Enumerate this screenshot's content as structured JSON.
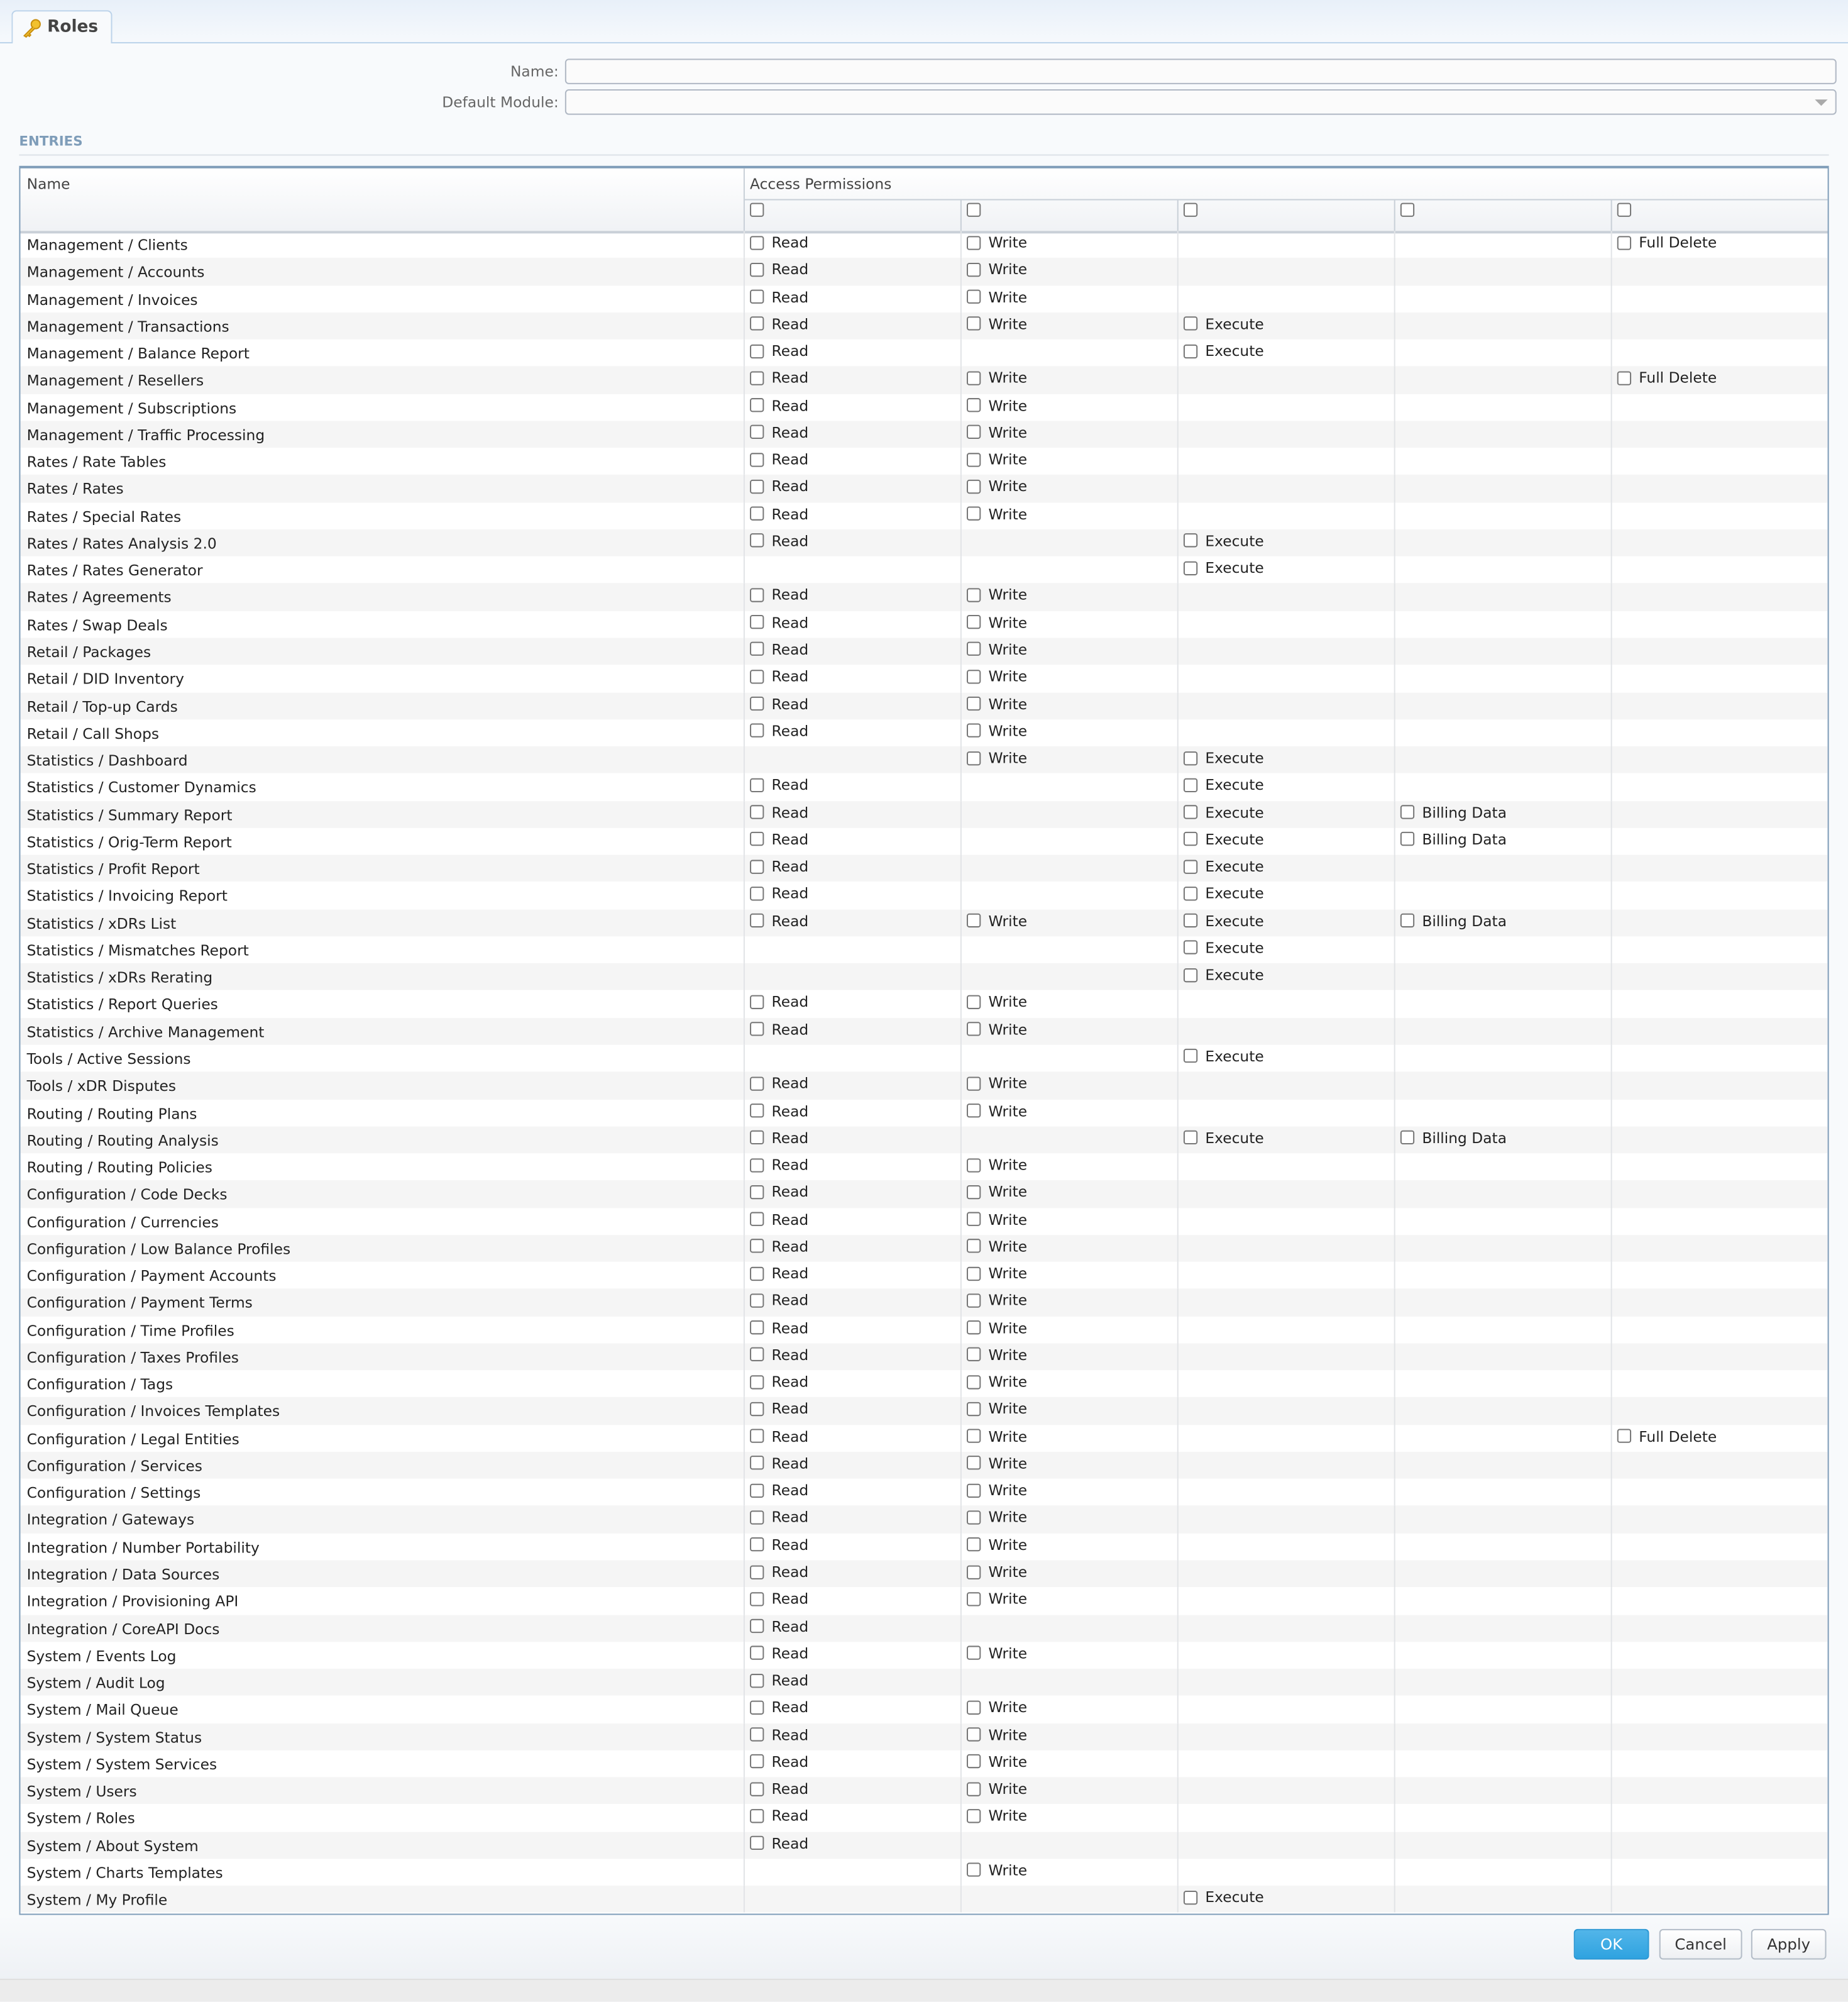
{
  "tab": {
    "title": "Roles",
    "icon": "key-icon"
  },
  "form": {
    "name_label": "Name:",
    "name_value": "",
    "module_label": "Default Module:",
    "module_value": ""
  },
  "section_title": "ENTRIES",
  "table": {
    "col_name": "Name",
    "col_permissions": "Access Permissions",
    "perm_labels": {
      "R": "Read",
      "W": "Write",
      "E": "Execute",
      "B": "Billing Data",
      "F": "Full Delete"
    },
    "rows": [
      {
        "name": "Management / Clients",
        "p": "RW--F"
      },
      {
        "name": "Management / Accounts",
        "p": "RW---"
      },
      {
        "name": "Management / Invoices",
        "p": "RW---"
      },
      {
        "name": "Management / Transactions",
        "p": "RWE--"
      },
      {
        "name": "Management / Balance Report",
        "p": "R-E--"
      },
      {
        "name": "Management / Resellers",
        "p": "RW--F"
      },
      {
        "name": "Management / Subscriptions",
        "p": "RW---"
      },
      {
        "name": "Management / Traffic Processing",
        "p": "RW---"
      },
      {
        "name": "Rates / Rate Tables",
        "p": "RW---"
      },
      {
        "name": "Rates / Rates",
        "p": "RW---"
      },
      {
        "name": "Rates / Special Rates",
        "p": "RW---"
      },
      {
        "name": "Rates / Rates Analysis 2.0",
        "p": "R-E--"
      },
      {
        "name": "Rates / Rates Generator",
        "p": "--E--"
      },
      {
        "name": "Rates / Agreements",
        "p": "RW---"
      },
      {
        "name": "Rates / Swap Deals",
        "p": "RW---"
      },
      {
        "name": "Retail / Packages",
        "p": "RW---"
      },
      {
        "name": "Retail / DID Inventory",
        "p": "RW---"
      },
      {
        "name": "Retail / Top-up Cards",
        "p": "RW---"
      },
      {
        "name": "Retail / Call Shops",
        "p": "RW---"
      },
      {
        "name": "Statistics / Dashboard",
        "p": "-WE--"
      },
      {
        "name": "Statistics / Customer Dynamics",
        "p": "R-E--"
      },
      {
        "name": "Statistics / Summary Report",
        "p": "R-EB-"
      },
      {
        "name": "Statistics / Orig-Term Report",
        "p": "R-EB-"
      },
      {
        "name": "Statistics / Profit Report",
        "p": "R-E--"
      },
      {
        "name": "Statistics / Invoicing Report",
        "p": "R-E--"
      },
      {
        "name": "Statistics / xDRs List",
        "p": "RWEB-"
      },
      {
        "name": "Statistics / Mismatches Report",
        "p": "--E--"
      },
      {
        "name": "Statistics / xDRs Rerating",
        "p": "--E--"
      },
      {
        "name": "Statistics / Report Queries",
        "p": "RW---"
      },
      {
        "name": "Statistics / Archive Management",
        "p": "RW---"
      },
      {
        "name": "Tools / Active Sessions",
        "p": "--E--"
      },
      {
        "name": "Tools / xDR Disputes",
        "p": "RW---"
      },
      {
        "name": "Routing / Routing Plans",
        "p": "RW---"
      },
      {
        "name": "Routing / Routing Analysis",
        "p": "R-EB-"
      },
      {
        "name": "Routing / Routing Policies",
        "p": "RW---"
      },
      {
        "name": "Configuration / Code Decks",
        "p": "RW---"
      },
      {
        "name": "Configuration / Currencies",
        "p": "RW---"
      },
      {
        "name": "Configuration / Low Balance Profiles",
        "p": "RW---"
      },
      {
        "name": "Configuration / Payment Accounts",
        "p": "RW---"
      },
      {
        "name": "Configuration / Payment Terms",
        "p": "RW---"
      },
      {
        "name": "Configuration / Time Profiles",
        "p": "RW---"
      },
      {
        "name": "Configuration / Taxes Profiles",
        "p": "RW---"
      },
      {
        "name": "Configuration / Tags",
        "p": "RW---"
      },
      {
        "name": "Configuration / Invoices Templates",
        "p": "RW---"
      },
      {
        "name": "Configuration / Legal Entities",
        "p": "RW--F"
      },
      {
        "name": "Configuration / Services",
        "p": "RW---"
      },
      {
        "name": "Configuration / Settings",
        "p": "RW---"
      },
      {
        "name": "Integration / Gateways",
        "p": "RW---"
      },
      {
        "name": "Integration / Number Portability",
        "p": "RW---"
      },
      {
        "name": "Integration / Data Sources",
        "p": "RW---"
      },
      {
        "name": "Integration / Provisioning API",
        "p": "RW---"
      },
      {
        "name": "Integration / CoreAPI Docs",
        "p": "R----"
      },
      {
        "name": "System / Events Log",
        "p": "RW---"
      },
      {
        "name": "System / Audit Log",
        "p": "R----"
      },
      {
        "name": "System / Mail Queue",
        "p": "RW---"
      },
      {
        "name": "System / System Status",
        "p": "RW---"
      },
      {
        "name": "System / System Services",
        "p": "RW---"
      },
      {
        "name": "System / Users",
        "p": "RW---"
      },
      {
        "name": "System / Roles",
        "p": "RW---"
      },
      {
        "name": "System / About System",
        "p": "R----"
      },
      {
        "name": "System / Charts Templates",
        "p": "-W---"
      },
      {
        "name": "System / My Profile",
        "p": "--E--"
      }
    ]
  },
  "buttons": {
    "ok": "OK",
    "cancel": "Cancel",
    "apply": "Apply"
  },
  "colors": {
    "accent": "#2fa3e0",
    "border": "#7f9db9"
  }
}
